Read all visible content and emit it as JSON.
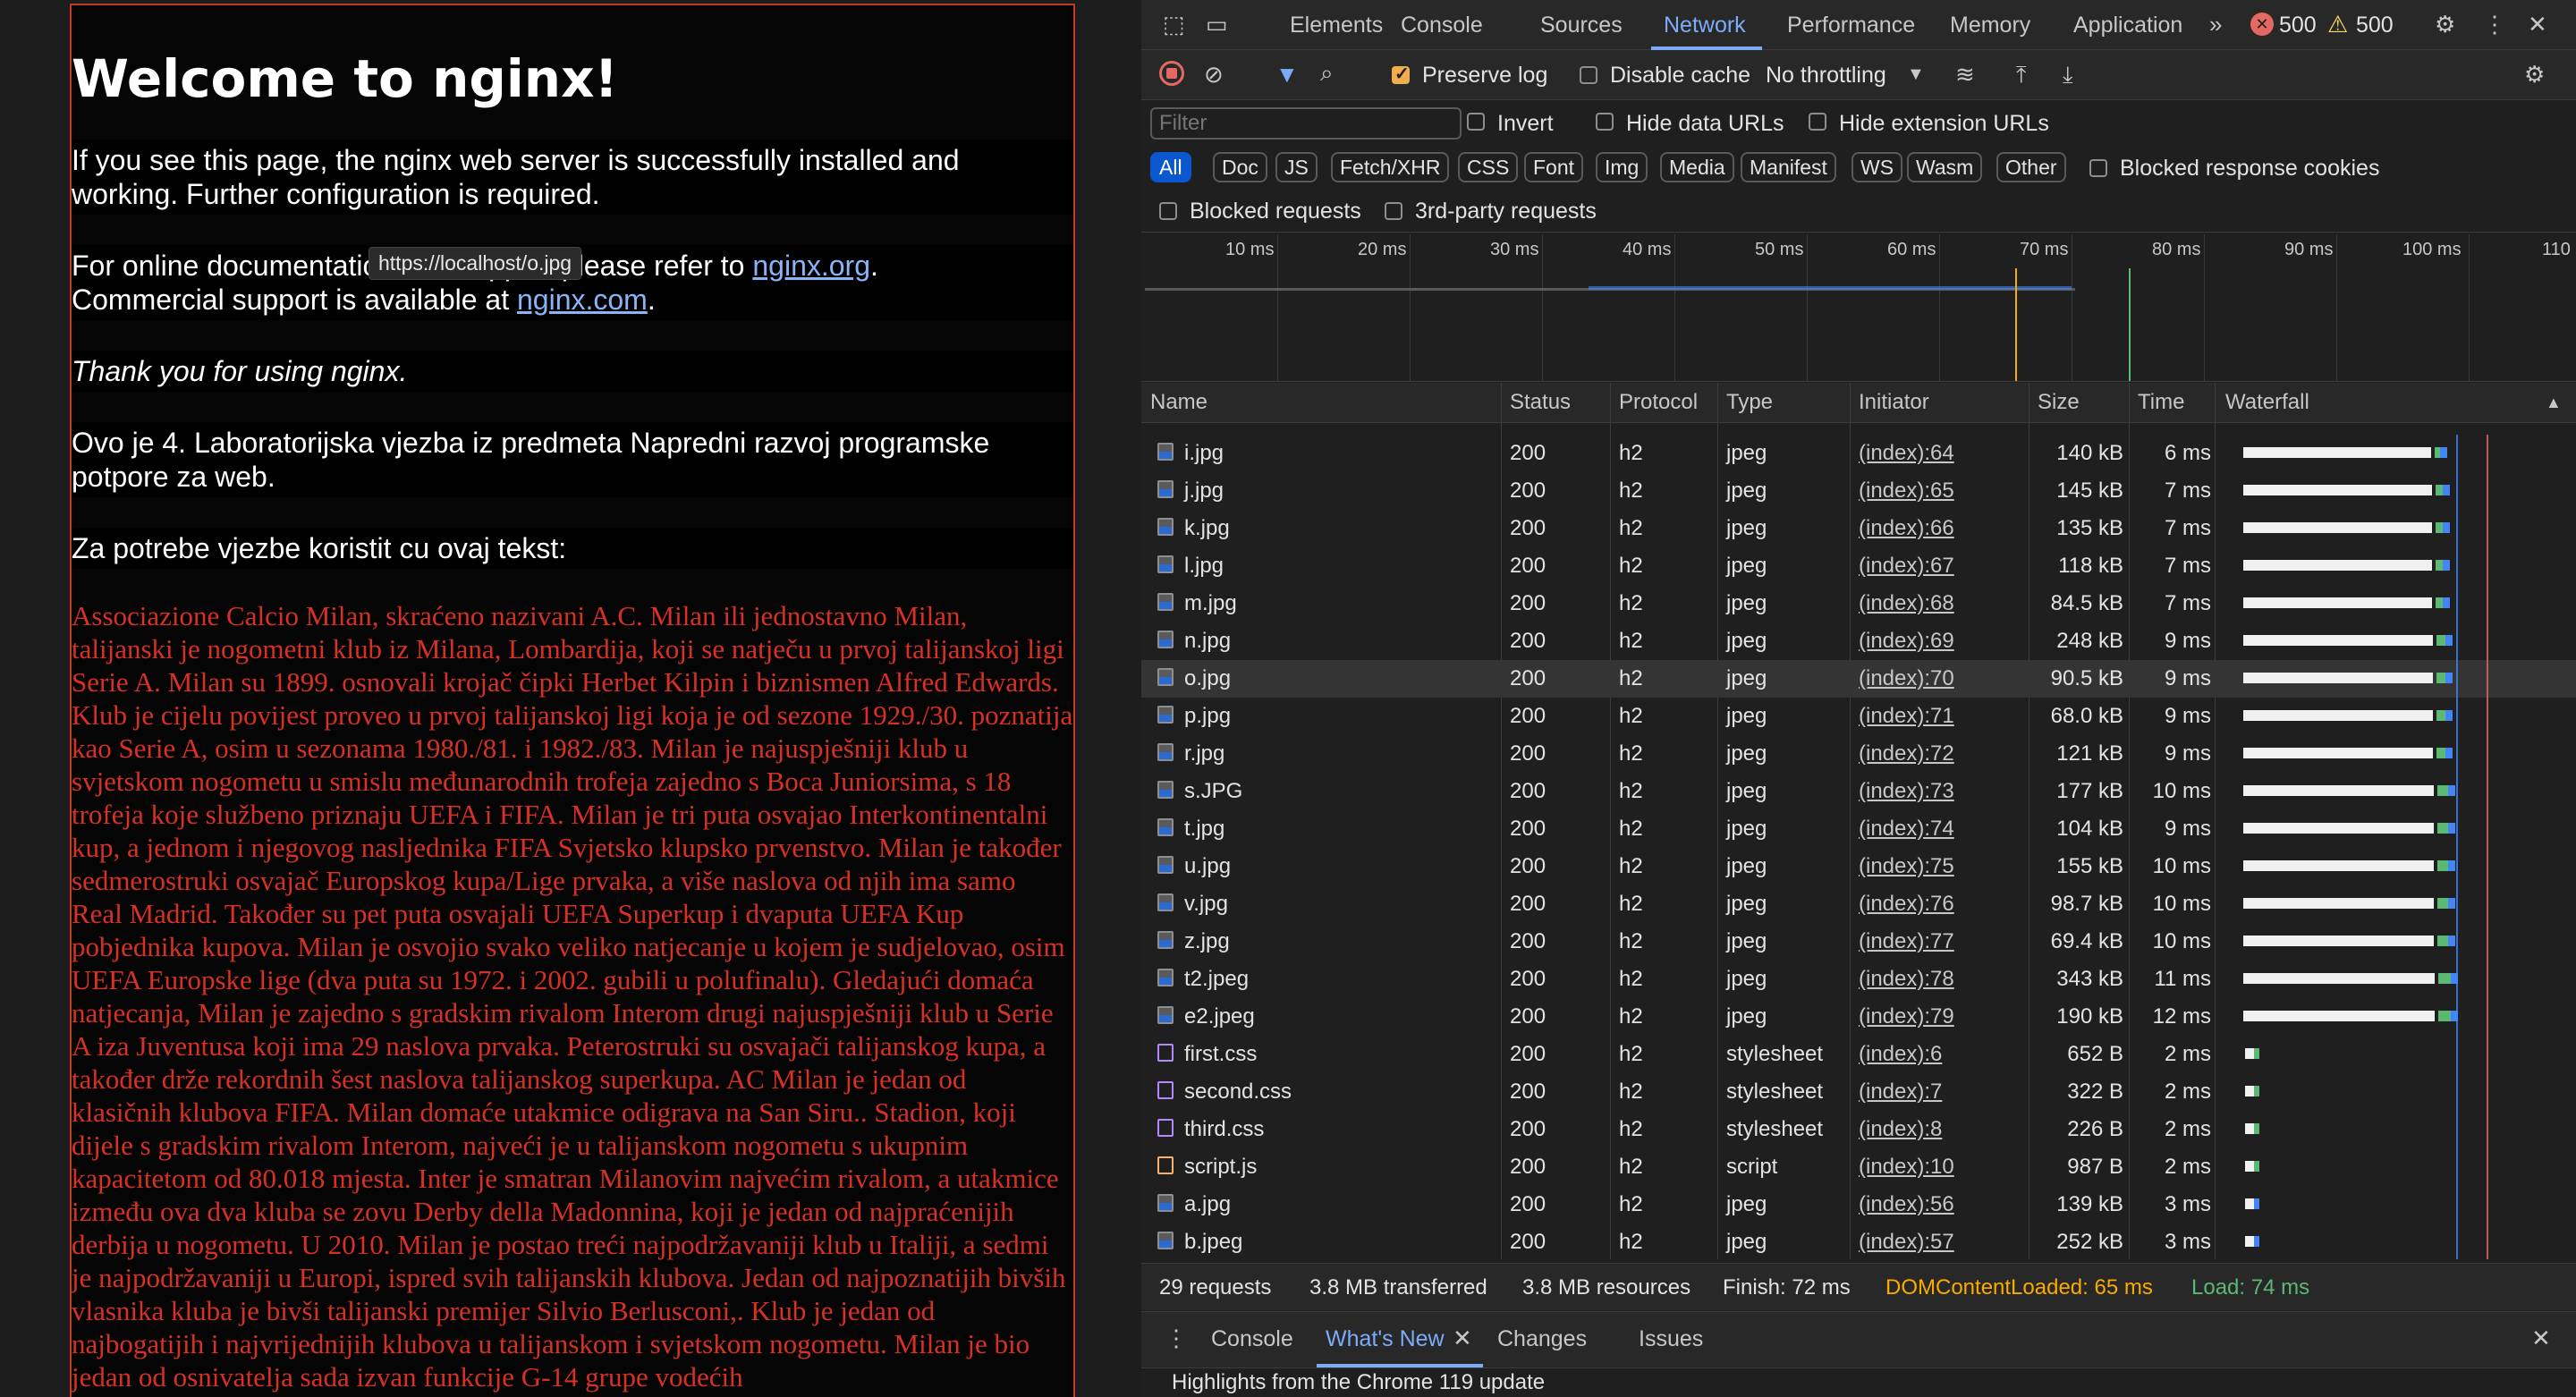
{
  "page": {
    "title": "Welcome to nginx!",
    "p1": "If you see this page, the nginx web server is successfully installed and working. Further configuration is required.",
    "p2_pre": "For online documentation and support please refer to",
    "p2_link": "nginx.org",
    "p2_mid": "Commercial support is available at",
    "p2_link2": "nginx.com",
    "p3": "Thank you for using nginx.",
    "p4": "Ovo je 4. Laboratorijska vjezba iz predmeta Napredni razvoj programske potpore za web.",
    "p5": "Za potrebe vjezbe koristit cu ovaj tekst:",
    "milan": "Associazione Calcio Milan, skraćeno nazivani A.C. Milan ili jednostavno Milan, talijanski je nogometni klub iz Milana, Lombardija, koji se natječu u prvoj talijanskoj ligi Serie A. Milan su 1899. osnovali krojač čipki Herbet Kilpin i biznismen Alfred Edwards. Klub je cijelu povijest proveo u prvoj talijanskoj ligi koja je od sezone 1929./30. poznatija kao Serie A, osim u sezonama 1980./81. i 1982./83. Milan je najuspješniji klub u svjetskom nogometu u smislu međunarodnih trofeja zajedno s Boca Juniorsima, s 18 trofeja koje službeno priznaju UEFA i FIFA. Milan je tri puta osvajao Interkontinentalni kup, a jednom i njegovog nasljednika FIFA Svjetsko klupsko prvenstvo. Milan je također sedmerostruki osvajač Europskog kupa/Lige prvaka, a više naslova od njih ima samo Real Madrid. Također su pet puta osvajali UEFA Superkup i dvaputa UEFA Kup pobjednika kupova. Milan je osvojio svako veliko natjecanje u kojem je sudjelovao, osim UEFA Europske lige (dva puta su 1972. i 2002. gubili u polufinalu). Gledajući domaća natjecanja, Milan je zajedno s gradskim rivalom Interom drugi najuspješniji klub u Serie A iza Juventusa koji ima 29 naslova prvaka. Peterostruki su osvajači talijanskog kupa, a također drže rekordnih šest naslova talijanskog superkupa. AC Milan je jedan od klasičnih klubova FIFA. Milan domaće utakmice odigrava na San Siru.. Stadion, koji dijele s gradskim rivalom Interom, najveći je u talijanskom nogometu s ukupnim kapacitetom od 80.018 mjesta. Inter je smatran Milanovim najvećim rivalom, a utakmice između ova dva kluba se zovu Derby della Madonnina, koji je jedan od najpraćenijih derbija u nogometu. U 2010. Milan je postao treći najpodržavaniji klub u Italiji, a sedmi je najpodržavaniji u Europi, ispred svih talijanskih klubova. Jedan od najpoznatijih bivših vlasnika kluba je bivši talijanski premijer Silvio Berlusconi,. Klub je jedan od najbogatijih i najvrijednijih klubova u talijanskom i svjetskom nogometu. Milan je bio jedan od osnivatelja sada izvan funkcije G-14 grupe vodećih",
    "tooltip": "https://localhost/o.jpg"
  },
  "devtools": {
    "tabs": [
      "Elements",
      "Console",
      "Sources",
      "Network",
      "Performance",
      "Memory",
      "Application"
    ],
    "active_tab": "Network",
    "errors": "500",
    "warnings": "500",
    "preserve_log": "Preserve log",
    "disable_cache": "Disable cache",
    "throttling": "No throttling",
    "filter_placeholder": "Filter",
    "invert": "Invert",
    "hide_data_urls": "Hide data URLs",
    "hide_ext_urls": "Hide extension URLs",
    "types": [
      "All",
      "Doc",
      "JS",
      "Fetch/XHR",
      "CSS",
      "Font",
      "Img",
      "Media",
      "Manifest",
      "WS",
      "Wasm",
      "Other"
    ],
    "blocked_cookies": "Blocked response cookies",
    "blocked_requests": "Blocked requests",
    "third_party": "3rd-party requests",
    "ticks": [
      "10 ms",
      "20 ms",
      "30 ms",
      "40 ms",
      "50 ms",
      "60 ms",
      "70 ms",
      "80 ms",
      "90 ms",
      "100 ms",
      "110"
    ],
    "columns": [
      "Name",
      "Status",
      "Protocol",
      "Type",
      "Initiator",
      "Size",
      "Time",
      "Waterfall"
    ],
    "rows": [
      {
        "name": "i.jpg",
        "status": "200",
        "proto": "h2",
        "type": "jpeg",
        "init": "(index):64",
        "size": "140 kB",
        "time": "6 ms",
        "kind": "img",
        "wf": 0.0
      },
      {
        "name": "j.jpg",
        "status": "200",
        "proto": "h2",
        "type": "jpeg",
        "init": "(index):65",
        "size": "145 kB",
        "time": "7 ms",
        "kind": "img",
        "wf": 0.1
      },
      {
        "name": "k.jpg",
        "status": "200",
        "proto": "h2",
        "type": "jpeg",
        "init": "(index):66",
        "size": "135 kB",
        "time": "7 ms",
        "kind": "img",
        "wf": 0.1
      },
      {
        "name": "l.jpg",
        "status": "200",
        "proto": "h2",
        "type": "jpeg",
        "init": "(index):67",
        "size": "118 kB",
        "time": "7 ms",
        "kind": "img",
        "wf": 0.1
      },
      {
        "name": "m.jpg",
        "status": "200",
        "proto": "h2",
        "type": "jpeg",
        "init": "(index):68",
        "size": "84.5 kB",
        "time": "7 ms",
        "kind": "img",
        "wf": 0.1
      },
      {
        "name": "n.jpg",
        "status": "200",
        "proto": "h2",
        "type": "jpeg",
        "init": "(index):69",
        "size": "248 kB",
        "time": "9 ms",
        "kind": "img",
        "wf": 0.2
      },
      {
        "name": "o.jpg",
        "status": "200",
        "proto": "h2",
        "type": "jpeg",
        "init": "(index):70",
        "size": "90.5 kB",
        "time": "9 ms",
        "kind": "img",
        "wf": 0.2,
        "hl": true
      },
      {
        "name": "p.jpg",
        "status": "200",
        "proto": "h2",
        "type": "jpeg",
        "init": "(index):71",
        "size": "68.0 kB",
        "time": "9 ms",
        "kind": "img",
        "wf": 0.2
      },
      {
        "name": "r.jpg",
        "status": "200",
        "proto": "h2",
        "type": "jpeg",
        "init": "(index):72",
        "size": "121 kB",
        "time": "9 ms",
        "kind": "img",
        "wf": 0.2
      },
      {
        "name": "s.JPG",
        "status": "200",
        "proto": "h2",
        "type": "jpeg",
        "init": "(index):73",
        "size": "177 kB",
        "time": "10 ms",
        "kind": "img",
        "wf": 0.3
      },
      {
        "name": "t.jpg",
        "status": "200",
        "proto": "h2",
        "type": "jpeg",
        "init": "(index):74",
        "size": "104 kB",
        "time": "9 ms",
        "kind": "img",
        "wf": 0.3
      },
      {
        "name": "u.jpg",
        "status": "200",
        "proto": "h2",
        "type": "jpeg",
        "init": "(index):75",
        "size": "155 kB",
        "time": "10 ms",
        "kind": "img",
        "wf": 0.3
      },
      {
        "name": "v.jpg",
        "status": "200",
        "proto": "h2",
        "type": "jpeg",
        "init": "(index):76",
        "size": "98.7 kB",
        "time": "10 ms",
        "kind": "img",
        "wf": 0.3
      },
      {
        "name": "z.jpg",
        "status": "200",
        "proto": "h2",
        "type": "jpeg",
        "init": "(index):77",
        "size": "69.4 kB",
        "time": "10 ms",
        "kind": "img",
        "wf": 0.3
      },
      {
        "name": "t2.jpeg",
        "status": "200",
        "proto": "h2",
        "type": "jpeg",
        "init": "(index):78",
        "size": "343 kB",
        "time": "11 ms",
        "kind": "img",
        "wf": 0.4
      },
      {
        "name": "e2.jpeg",
        "status": "200",
        "proto": "h2",
        "type": "jpeg",
        "init": "(index):79",
        "size": "190 kB",
        "time": "12 ms",
        "kind": "img",
        "wf": 0.4
      },
      {
        "name": "first.css",
        "status": "200",
        "proto": "h2",
        "type": "stylesheet",
        "init": "(index):6",
        "size": "652 B",
        "time": "2 ms",
        "kind": "css",
        "wf": -1
      },
      {
        "name": "second.css",
        "status": "200",
        "proto": "h2",
        "type": "stylesheet",
        "init": "(index):7",
        "size": "322 B",
        "time": "2 ms",
        "kind": "css",
        "wf": -1
      },
      {
        "name": "third.css",
        "status": "200",
        "proto": "h2",
        "type": "stylesheet",
        "init": "(index):8",
        "size": "226 B",
        "time": "2 ms",
        "kind": "css",
        "wf": -1
      },
      {
        "name": "script.js",
        "status": "200",
        "proto": "h2",
        "type": "script",
        "init": "(index):10",
        "size": "987 B",
        "time": "2 ms",
        "kind": "js",
        "wf": -1
      },
      {
        "name": "a.jpg",
        "status": "200",
        "proto": "h2",
        "type": "jpeg",
        "init": "(index):56",
        "size": "139 kB",
        "time": "3 ms",
        "kind": "img",
        "wf": -1
      },
      {
        "name": "b.jpeg",
        "status": "200",
        "proto": "h2",
        "type": "jpeg",
        "init": "(index):57",
        "size": "252 kB",
        "time": "3 ms",
        "kind": "img",
        "wf": -1
      }
    ],
    "summary": {
      "requests": "29 requests",
      "transferred": "3.8 MB transferred",
      "resources": "3.8 MB resources",
      "finish": "Finish: 72 ms",
      "dcl": "DOMContentLoaded: 65 ms",
      "load": "Load: 74 ms"
    },
    "drawer_tabs": [
      "Console",
      "What's New",
      "Changes",
      "Issues"
    ],
    "drawer_active": "What's New",
    "drawer_text": "Highlights from the Chrome 119 update",
    "colors": {
      "accent": "#7cacf8",
      "dcl": "#f9ab00",
      "load": "#5bb974",
      "error": "#f28b82",
      "warning": "#fdd663"
    }
  }
}
